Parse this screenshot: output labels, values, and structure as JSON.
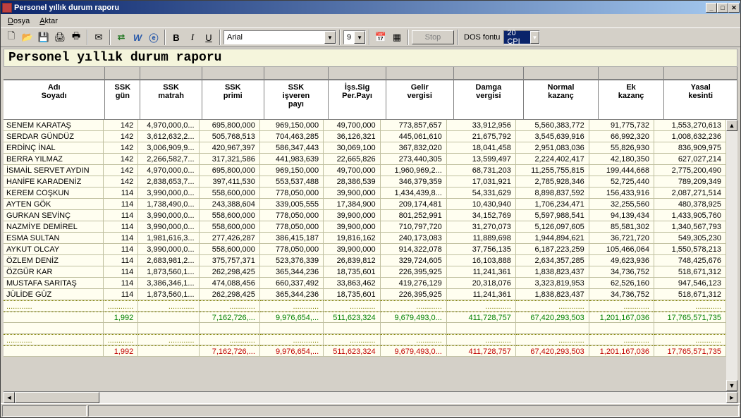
{
  "window": {
    "title": "Personel yıllık durum raporu"
  },
  "menu": {
    "dosya": "Dosya",
    "aktar": "Aktar"
  },
  "toolbar": {
    "font": "Arial",
    "size": "9",
    "stop": "Stop",
    "dos_label": "DOS fontu",
    "cpi": "20 CPI"
  },
  "report_title": "Personel yıllık durum raporu",
  "columns": [
    "Adı Soyadı",
    "SSK gün",
    "SSK matrah",
    "SSK primi",
    "SSK işveren payı",
    "İşs.Sig Per.Payı",
    "Gelir vergisi",
    "Damga vergisi",
    "Normal kazanç",
    "Ek kazanç",
    "Yasal kesinti"
  ],
  "rows": [
    [
      "SENEM KARATAŞ",
      "142",
      "4,970,000,0...",
      "695,800,000",
      "969,150,000",
      "49,700,000",
      "773,857,657",
      "33,912,956",
      "5,560,383,772",
      "91,775,732",
      "1,553,270,613"
    ],
    [
      "SERDAR GÜNDÜZ",
      "142",
      "3,612,632,2...",
      "505,768,513",
      "704,463,285",
      "36,126,321",
      "445,061,610",
      "21,675,792",
      "3,545,639,916",
      "66,992,320",
      "1,008,632,236"
    ],
    [
      "ERDİNÇ İNAL",
      "142",
      "3,006,909,9...",
      "420,967,397",
      "586,347,443",
      "30,069,100",
      "367,832,020",
      "18,041,458",
      "2,951,083,036",
      "55,826,930",
      "836,909,975"
    ],
    [
      "BERRA YILMAZ",
      "142",
      "2,266,582,7...",
      "317,321,586",
      "441,983,639",
      "22,665,826",
      "273,440,305",
      "13,599,497",
      "2,224,402,417",
      "42,180,350",
      "627,027,214"
    ],
    [
      "İSMAİL SERVET AYDIN",
      "142",
      "4,970,000,0...",
      "695,800,000",
      "969,150,000",
      "49,700,000",
      "1,960,969,2...",
      "68,731,203",
      "11,255,755,815",
      "199,444,668",
      "2,775,200,490"
    ],
    [
      "HANİFE KARADENİZ",
      "142",
      "2,838,653,7...",
      "397,411,530",
      "553,537,488",
      "28,386,539",
      "346,379,359",
      "17,031,921",
      "2,785,928,346",
      "52,725,440",
      "789,209,349"
    ],
    [
      "KEREM COŞKUN",
      "114",
      "3,990,000,0...",
      "558,600,000",
      "778,050,000",
      "39,900,000",
      "1,434,439,8...",
      "54,331,629",
      "8,898,837,592",
      "156,433,916",
      "2,087,271,514"
    ],
    [
      "AYTEN GÖK",
      "114",
      "1,738,490,0...",
      "243,388,604",
      "339,005,555",
      "17,384,900",
      "209,174,481",
      "10,430,940",
      "1,706,234,471",
      "32,255,560",
      "480,378,925"
    ],
    [
      "GURKAN SEVİNÇ",
      "114",
      "3,990,000,0...",
      "558,600,000",
      "778,050,000",
      "39,900,000",
      "801,252,991",
      "34,152,769",
      "5,597,988,541",
      "94,139,434",
      "1,433,905,760"
    ],
    [
      "NAZMİYE DEMİREL",
      "114",
      "3,990,000,0...",
      "558,600,000",
      "778,050,000",
      "39,900,000",
      "710,797,720",
      "31,270,073",
      "5,126,097,605",
      "85,581,302",
      "1,340,567,793"
    ],
    [
      "ESMA SULTAN",
      "114",
      "1,981,616,3...",
      "277,426,287",
      "386,415,187",
      "19,816,162",
      "240,173,083",
      "11,889,698",
      "1,944,894,621",
      "36,721,720",
      "549,305,230"
    ],
    [
      "AYKUT OLCAY",
      "114",
      "3,990,000,0...",
      "558,600,000",
      "778,050,000",
      "39,900,000",
      "914,322,078",
      "37,756,135",
      "6,187,223,259",
      "105,466,064",
      "1,550,578,213"
    ],
    [
      "ÖZLEM DENİZ",
      "114",
      "2,683,981,2...",
      "375,757,371",
      "523,376,339",
      "26,839,812",
      "329,724,605",
      "16,103,888",
      "2,634,357,285",
      "49,623,936",
      "748,425,676"
    ],
    [
      "ÖZGÜR KAR",
      "114",
      "1,873,560,1...",
      "262,298,425",
      "365,344,236",
      "18,735,601",
      "226,395,925",
      "11,241,361",
      "1,838,823,437",
      "34,736,752",
      "518,671,312"
    ],
    [
      "MUSTAFA SARITAŞ",
      "114",
      "3,386,346,1...",
      "474,088,456",
      "660,337,492",
      "33,863,462",
      "419,276,129",
      "20,318,076",
      "3,323,819,953",
      "62,526,160",
      "947,546,123"
    ],
    [
      "JÜLİDE GÜZ",
      "114",
      "1,873,560,1...",
      "262,298,425",
      "365,344,236",
      "18,735,601",
      "226,395,925",
      "11,241,361",
      "1,838,823,437",
      "34,736,752",
      "518,671,312"
    ]
  ],
  "subtotal": [
    "",
    "1,992",
    "",
    "7,162,726,...",
    "9,976,654,...",
    "511,623,324",
    "9,679,493,0...",
    "411,728,757",
    "67,420,293,503",
    "1,201,167,036",
    "17,765,571,735"
  ],
  "total": [
    "",
    "1,992",
    "",
    "7,162,726,...",
    "9,976,654,...",
    "511,623,324",
    "9,679,493,0...",
    "411,728,757",
    "67,420,293,503",
    "1,201,167,036",
    "17,765,571,735"
  ],
  "chart_data": {
    "type": "table",
    "title": "Personel yıllık durum raporu",
    "columns": [
      "Adı Soyadı",
      "SSK gün",
      "SSK matrah",
      "SSK primi",
      "SSK işveren payı",
      "İşs.Sig Per.Payı",
      "Gelir vergisi",
      "Damga vergisi",
      "Normal kazanç",
      "Ek kazanç",
      "Yasal kesinti"
    ]
  }
}
